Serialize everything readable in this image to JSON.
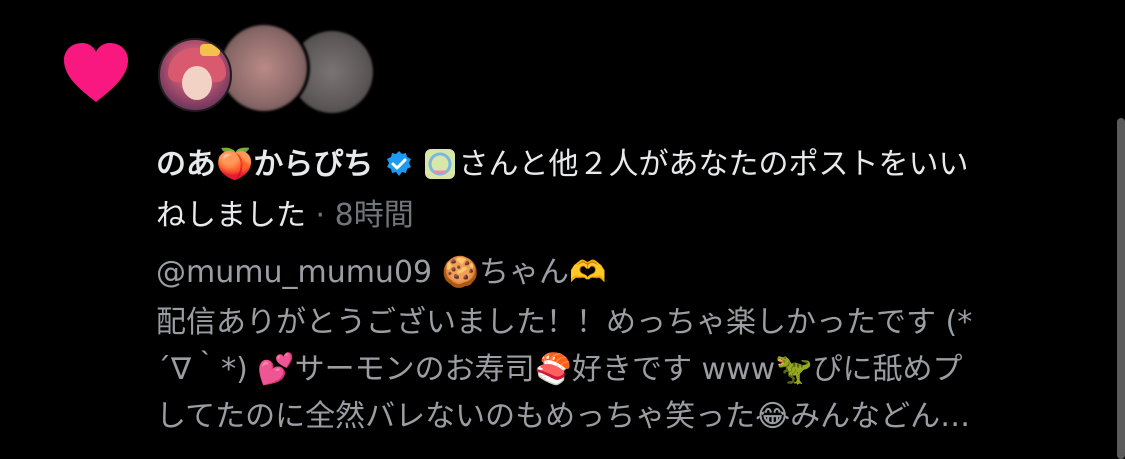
{
  "notification": {
    "type_icon": "heart-icon",
    "heart_color": "#f91880",
    "actor_name": "のあ🍑からぴち",
    "verified_icon": "verified-badge-icon",
    "verified_color": "#1d9bf0",
    "affiliate_icon": "organization-badge-icon",
    "action_text_line1": "さんと他２人があなたのポストをいい",
    "action_text_line2": "ねしました",
    "separator": " · ",
    "time": "8時間"
  },
  "post": {
    "line1": "@mumu_mumu09 🍪ちゃん🫶",
    "line2": "配信ありがとうございました！！めっちゃ楽しかったです (*",
    "line3": "´∇｀*) 💕サーモンのお寿司🍣好きです www🦖ぴに舐めプ",
    "line4": "してたのに全然バレないのもめっちゃ笑った😂みんなどん…"
  },
  "avatars": [
    {
      "name": "avatar-noa-icon"
    },
    {
      "name": "avatar-blurred-icon"
    },
    {
      "name": "avatar-blurred-icon"
    }
  ],
  "colors": {
    "background": "#000000",
    "text_primary": "#e7e9ea",
    "text_secondary": "#71767b"
  }
}
